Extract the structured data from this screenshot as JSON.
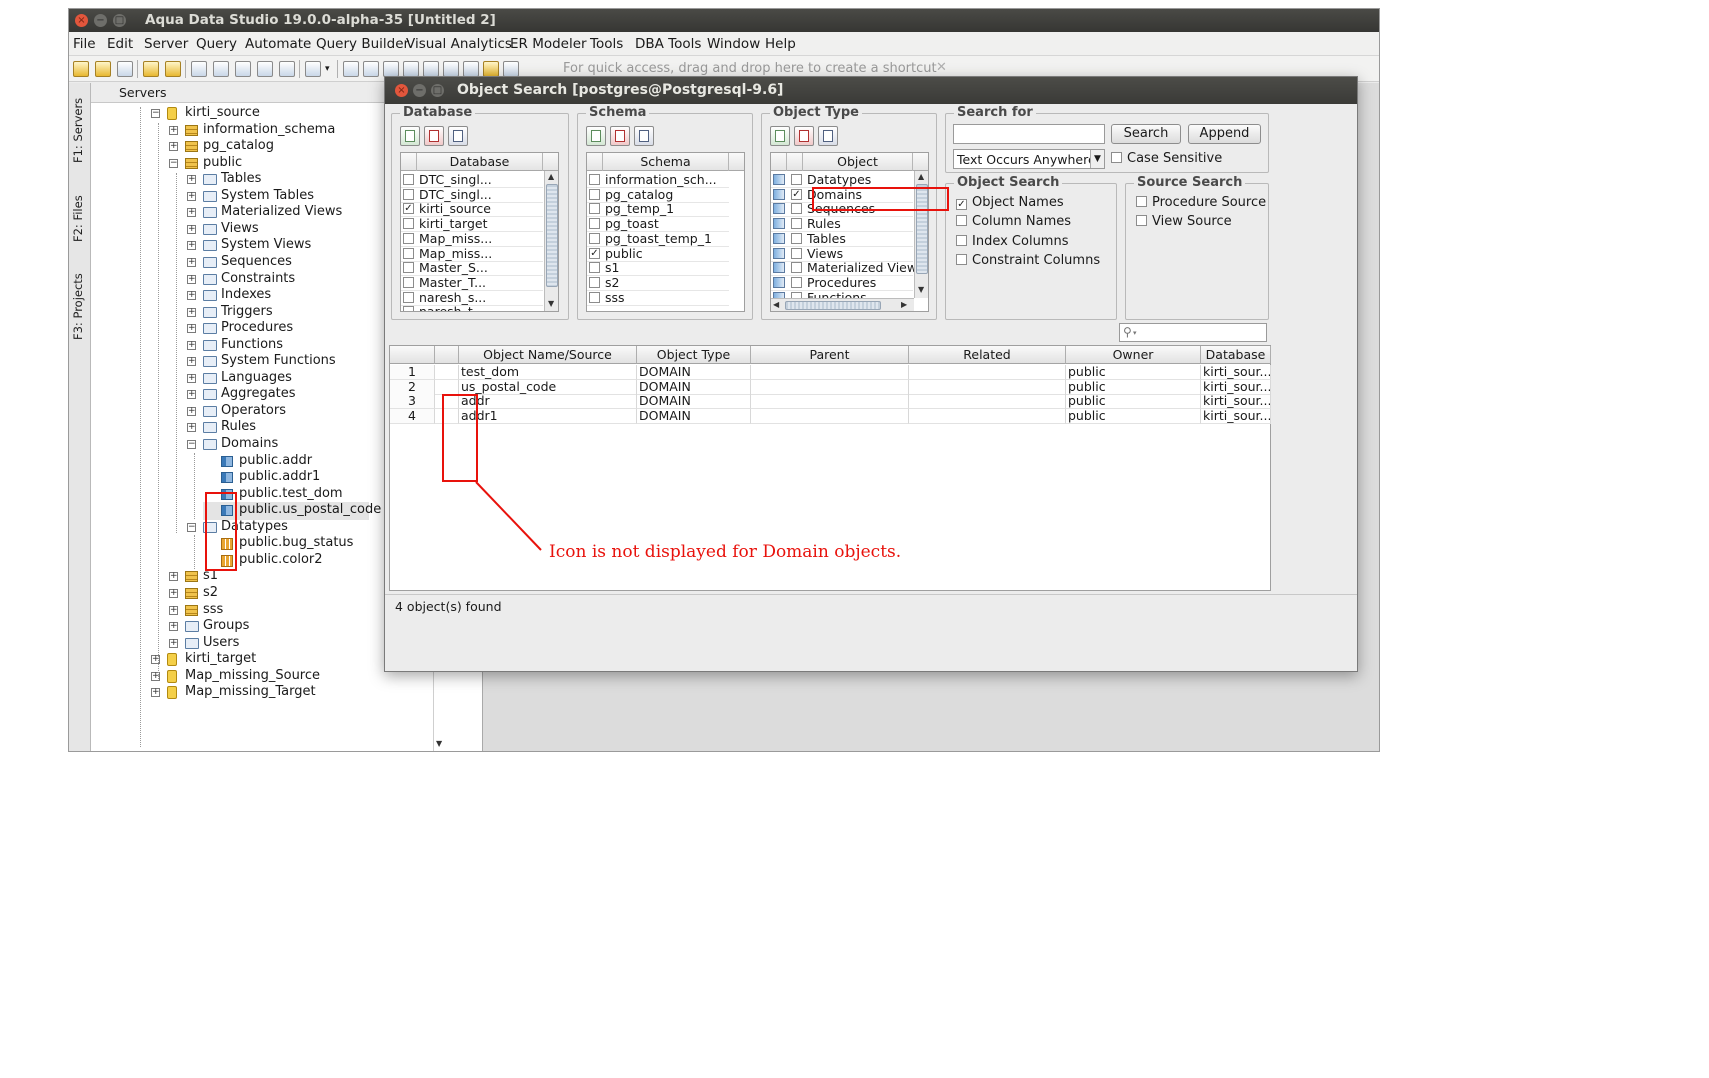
{
  "window": {
    "title": "Aqua Data Studio 19.0.0-alpha-35 [Untitled 2]"
  },
  "menu": [
    {
      "label": "File",
      "name": "menu-file"
    },
    {
      "label": "Edit",
      "name": "menu-edit"
    },
    {
      "label": "Server",
      "name": "menu-server"
    },
    {
      "label": "Query",
      "name": "menu-query"
    },
    {
      "label": "Automate",
      "name": "menu-automate"
    },
    {
      "label": "Query Builder",
      "name": "menu-query-builder"
    },
    {
      "label": "Visual Analytics",
      "name": "menu-visual-analytics"
    },
    {
      "label": "ER Modeler",
      "name": "menu-er-modeler"
    },
    {
      "label": "Tools",
      "name": "menu-tools"
    },
    {
      "label": "DBA Tools",
      "name": "menu-dba-tools"
    },
    {
      "label": "Window",
      "name": "menu-window"
    },
    {
      "label": "Help",
      "name": "menu-help"
    }
  ],
  "toolbar": {
    "shortcut_hint": "For quick access, drag and drop here to create a shortcut"
  },
  "side_tabs": {
    "servers": "F1: Servers",
    "files": "F2: Files",
    "projects": "F3: Projects"
  },
  "servers": {
    "header": "Servers",
    "tree": [
      {
        "label": "kirti_source",
        "icon": "database-icon",
        "expander": "minus"
      },
      {
        "label": "information_schema",
        "icon": "schema-icon",
        "expander": "plus"
      },
      {
        "label": "pg_catalog",
        "icon": "schema-icon",
        "expander": "plus"
      },
      {
        "label": "public",
        "icon": "schema-icon",
        "expander": "minus"
      },
      {
        "label": "Tables",
        "icon": "folder-icon",
        "expander": "plus"
      },
      {
        "label": "System Tables",
        "icon": "folder-icon",
        "expander": "plus"
      },
      {
        "label": "Materialized Views",
        "icon": "folder-icon",
        "expander": "plus"
      },
      {
        "label": "Views",
        "icon": "folder-icon",
        "expander": "plus"
      },
      {
        "label": "System Views",
        "icon": "folder-icon",
        "expander": "plus"
      },
      {
        "label": "Sequences",
        "icon": "folder-icon",
        "expander": "plus"
      },
      {
        "label": "Constraints",
        "icon": "folder-icon",
        "expander": "plus"
      },
      {
        "label": "Indexes",
        "icon": "folder-icon",
        "expander": "plus"
      },
      {
        "label": "Triggers",
        "icon": "folder-icon",
        "expander": "plus"
      },
      {
        "label": "Procedures",
        "icon": "folder-icon",
        "expander": "plus"
      },
      {
        "label": "Functions",
        "icon": "folder-icon",
        "expander": "plus"
      },
      {
        "label": "System Functions",
        "icon": "folder-icon",
        "expander": "plus"
      },
      {
        "label": "Languages",
        "icon": "folder-icon",
        "expander": "plus"
      },
      {
        "label": "Aggregates",
        "icon": "folder-icon",
        "expander": "plus"
      },
      {
        "label": "Operators",
        "icon": "folder-icon",
        "expander": "plus"
      },
      {
        "label": "Rules",
        "icon": "folder-icon",
        "expander": "plus"
      },
      {
        "label": "Domains",
        "icon": "folder-icon",
        "expander": "minus"
      },
      {
        "label": "public.addr",
        "icon": "domain-icon",
        "expander": ""
      },
      {
        "label": "public.addr1",
        "icon": "domain-icon",
        "expander": ""
      },
      {
        "label": "public.test_dom",
        "icon": "domain-icon",
        "expander": ""
      },
      {
        "label": "public.us_postal_code",
        "icon": "domain-icon",
        "expander": "",
        "selected": true
      },
      {
        "label": "Datatypes",
        "icon": "folder-icon",
        "expander": "minus"
      },
      {
        "label": "public.bug_status",
        "icon": "datatype-icon",
        "expander": ""
      },
      {
        "label": "public.color2",
        "icon": "datatype-icon",
        "expander": ""
      },
      {
        "label": "s1",
        "icon": "schema-icon",
        "expander": "plus"
      },
      {
        "label": "s2",
        "icon": "schema-icon",
        "expander": "plus"
      },
      {
        "label": "sss",
        "icon": "schema-icon",
        "expander": "plus"
      },
      {
        "label": "Groups",
        "icon": "folder-icon",
        "expander": "plus"
      },
      {
        "label": "Users",
        "icon": "folder-icon",
        "expander": "plus"
      },
      {
        "label": "kirti_target",
        "icon": "database-icon",
        "expander": "plus"
      },
      {
        "label": "Map_missing_Source",
        "icon": "database-icon",
        "expander": "plus"
      },
      {
        "label": "Map_missing_Target",
        "icon": "database-icon",
        "expander": "plus"
      }
    ]
  },
  "dialog": {
    "title": "Object Search [postgres@Postgresql-9.6]",
    "database_group": {
      "title": "Database",
      "column": "Database",
      "items": [
        {
          "label": "DTC_singl...",
          "checked": false
        },
        {
          "label": "DTC_singl...",
          "checked": false
        },
        {
          "label": "kirti_source",
          "checked": true
        },
        {
          "label": "kirti_target",
          "checked": false
        },
        {
          "label": "Map_miss...",
          "checked": false
        },
        {
          "label": "Map_miss...",
          "checked": false
        },
        {
          "label": "Master_S...",
          "checked": false
        },
        {
          "label": "Master_T...",
          "checked": false
        },
        {
          "label": "naresh_s...",
          "checked": false
        },
        {
          "label": "naresh_t...",
          "checked": false
        }
      ]
    },
    "schema_group": {
      "title": "Schema",
      "column": "Schema",
      "items": [
        {
          "label": "information_sch...",
          "checked": false
        },
        {
          "label": "pg_catalog",
          "checked": false
        },
        {
          "label": "pg_temp_1",
          "checked": false
        },
        {
          "label": "pg_toast",
          "checked": false
        },
        {
          "label": "pg_toast_temp_1",
          "checked": false
        },
        {
          "label": "public",
          "checked": true
        },
        {
          "label": "s1",
          "checked": false
        },
        {
          "label": "s2",
          "checked": false
        },
        {
          "label": "sss",
          "checked": false
        }
      ]
    },
    "object_type_group": {
      "title": "Object Type",
      "column": "Object",
      "items": [
        {
          "label": "Datatypes",
          "checked": false,
          "icon": "datatype-icon"
        },
        {
          "label": "Domains",
          "checked": true,
          "icon": "domain-icon"
        },
        {
          "label": "Sequences",
          "checked": false,
          "icon": "sequence-icon"
        },
        {
          "label": "Rules",
          "checked": false,
          "icon": "rule-icon"
        },
        {
          "label": "Tables",
          "checked": false,
          "icon": "table-icon"
        },
        {
          "label": "Views",
          "checked": false,
          "icon": "view-icon"
        },
        {
          "label": "Materialized Views",
          "checked": false,
          "icon": "materialized-view-icon"
        },
        {
          "label": "Procedures",
          "checked": false,
          "icon": "procedure-icon"
        },
        {
          "label": "Functions",
          "checked": false,
          "icon": "function-icon"
        }
      ]
    },
    "search_for": {
      "title": "Search for",
      "value": "",
      "search_button": "Search",
      "append_button": "Append",
      "mode": "Text Occurs Anywhere",
      "case_sensitive_label": "Case Sensitive",
      "case_sensitive": false
    },
    "object_search": {
      "title": "Object Search",
      "options": [
        {
          "label": "Object Names",
          "checked": true
        },
        {
          "label": "Column Names",
          "checked": false
        },
        {
          "label": "Index Columns",
          "checked": false
        },
        {
          "label": "Constraint Columns",
          "checked": false
        }
      ]
    },
    "source_search": {
      "title": "Source Search",
      "options": [
        {
          "label": "Procedure Source",
          "checked": false
        },
        {
          "label": "View Source",
          "checked": false
        }
      ]
    },
    "filter": {
      "value": ""
    },
    "results": {
      "columns": [
        "",
        "",
        "Object Name/Source",
        "Object Type",
        "Parent",
        "Related",
        "Owner",
        "Database"
      ],
      "rows": [
        {
          "num": "1",
          "name": "test_dom",
          "type": "DOMAIN",
          "parent": "",
          "related": "",
          "owner": "public",
          "database": "kirti_sour..."
        },
        {
          "num": "2",
          "name": "us_postal_code",
          "type": "DOMAIN",
          "parent": "",
          "related": "",
          "owner": "public",
          "database": "kirti_sour..."
        },
        {
          "num": "3",
          "name": "addr",
          "type": "DOMAIN",
          "parent": "",
          "related": "",
          "owner": "public",
          "database": "kirti_sour..."
        },
        {
          "num": "4",
          "name": "addr1",
          "type": "DOMAIN",
          "parent": "",
          "related": "",
          "owner": "public",
          "database": "kirti_sour..."
        }
      ]
    },
    "status": "4 object(s) found"
  },
  "annotation": {
    "text": "Icon is not displayed for Domain objects.",
    "color": "#e8120c"
  }
}
